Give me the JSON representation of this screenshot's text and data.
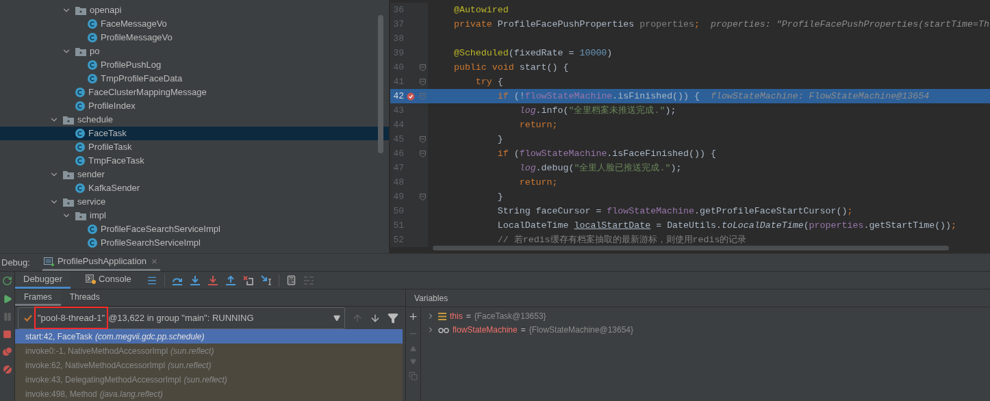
{
  "project_tree": {
    "items": [
      {
        "children": [
          {
            "label": "openapi",
            "kind": "folder",
            "expanded": true,
            "selected": false,
            "children": [
              {
                "label": "FaceMessageVo",
                "kind": "class",
                "selected": false
              },
              {
                "label": "ProfileMessageVo",
                "kind": "class",
                "selected": false
              }
            ]
          },
          {
            "label": "po",
            "kind": "folder",
            "expanded": true,
            "selected": false,
            "children": [
              {
                "label": "ProfilePushLog",
                "kind": "class",
                "selected": false
              },
              {
                "label": "TmpProfileFaceData",
                "kind": "class",
                "selected": false
              }
            ]
          },
          {
            "label": "FaceClusterMappingMessage",
            "kind": "class",
            "selected": false
          },
          {
            "label": "ProfileIndex",
            "kind": "class",
            "selected": false
          }
        ]
      },
      {
        "label": "schedule",
        "kind": "folder",
        "expanded": true,
        "selected": false,
        "children": [
          {
            "label": "FaceTask",
            "kind": "class",
            "selected": true
          },
          {
            "label": "ProfileTask",
            "kind": "class",
            "selected": false
          },
          {
            "label": "TmpFaceTask",
            "kind": "class",
            "selected": false
          }
        ]
      },
      {
        "label": "sender",
        "kind": "folder",
        "expanded": true,
        "selected": false,
        "children": [
          {
            "label": "KafkaSender",
            "kind": "class",
            "selected": false
          }
        ]
      },
      {
        "label": "service",
        "kind": "folder",
        "expanded": true,
        "selected": false,
        "children": [
          {
            "label": "impl",
            "kind": "folder",
            "expanded": true,
            "selected": false,
            "children": [
              {
                "label": "ProfileFaceSearchServiceImpl",
                "kind": "class",
                "selected": false
              },
              {
                "label": "ProfileSearchServiceImpl",
                "kind": "class",
                "selected": false
              }
            ]
          }
        ]
      }
    ]
  },
  "editor": {
    "lines": [
      {
        "n": "36",
        "fold": false,
        "breakpoint": false,
        "current": false,
        "tokens": [
          {
            "text": "    @Autowired",
            "kind": "ann"
          }
        ]
      },
      {
        "n": "37",
        "fold": false,
        "breakpoint": false,
        "current": false,
        "tokens": [
          {
            "text": "    private ",
            "kind": "kw"
          },
          {
            "text": "ProfileFacePushProperties ",
            "kind": "plain"
          },
          {
            "text": "properties",
            "kind": "unused"
          },
          {
            "text": ";",
            "kind": "kw"
          },
          {
            "text": "  properties: \"ProfileFacePushProperties(startTime=Th",
            "kind": "hint"
          }
        ]
      },
      {
        "n": "38",
        "fold": false,
        "breakpoint": false,
        "current": false
      },
      {
        "n": "39",
        "fold": false,
        "breakpoint": false,
        "current": false,
        "tokens": [
          {
            "text": "    @Scheduled",
            "kind": "ann"
          },
          {
            "text": "(fixedRate = ",
            "kind": "plain"
          },
          {
            "text": "10000",
            "kind": "num"
          },
          {
            "text": ")",
            "kind": "plain"
          }
        ]
      },
      {
        "n": "40",
        "fold": true,
        "breakpoint": false,
        "current": false,
        "tokens": [
          {
            "text": "    public void ",
            "kind": "kw"
          },
          {
            "text": "start() {",
            "kind": "plain"
          }
        ]
      },
      {
        "n": "41",
        "fold": true,
        "breakpoint": false,
        "current": false,
        "tokens": [
          {
            "text": "        try ",
            "kind": "kw"
          },
          {
            "text": "{",
            "kind": "plain"
          }
        ]
      },
      {
        "n": "42",
        "fold": true,
        "breakpoint": true,
        "current": true,
        "tokens": [
          {
            "text": "            if ",
            "kind": "kw"
          },
          {
            "text": "(!",
            "kind": "plain"
          },
          {
            "text": "flowStateMachine",
            "kind": "field"
          },
          {
            "text": ".isFinished()) {",
            "kind": "plain"
          },
          {
            "text": "  flowStateMachine: FlowStateMachine@13654",
            "kind": "hint"
          }
        ]
      },
      {
        "n": "43",
        "fold": false,
        "breakpoint": false,
        "current": false,
        "tokens": [
          {
            "text": "                log",
            "kind": "static"
          },
          {
            "text": ".info(",
            "kind": "plain"
          },
          {
            "text": "\"全里档案未推送完成.\"",
            "kind": "str"
          },
          {
            "text": ");",
            "kind": "plain"
          }
        ]
      },
      {
        "n": "44",
        "fold": false,
        "breakpoint": false,
        "current": false,
        "tokens": [
          {
            "text": "                return;",
            "kind": "kw"
          }
        ]
      },
      {
        "n": "45",
        "fold": true,
        "breakpoint": false,
        "current": false,
        "tokens": [
          {
            "text": "            }",
            "kind": "plain"
          }
        ]
      },
      {
        "n": "46",
        "fold": true,
        "breakpoint": false,
        "current": false,
        "tokens": [
          {
            "text": "            if ",
            "kind": "kw"
          },
          {
            "text": "(",
            "kind": "plain"
          },
          {
            "text": "flowStateMachine",
            "kind": "field"
          },
          {
            "text": ".isFaceFinished()) {",
            "kind": "plain"
          }
        ]
      },
      {
        "n": "47",
        "fold": false,
        "breakpoint": false,
        "current": false,
        "tokens": [
          {
            "text": "                log",
            "kind": "static"
          },
          {
            "text": ".debug(",
            "kind": "plain"
          },
          {
            "text": "\"全里人脸已推送完成.\"",
            "kind": "str"
          },
          {
            "text": ");",
            "kind": "plain"
          }
        ]
      },
      {
        "n": "48",
        "fold": false,
        "breakpoint": false,
        "current": false,
        "tokens": [
          {
            "text": "                return;",
            "kind": "kw"
          }
        ]
      },
      {
        "n": "49",
        "fold": true,
        "breakpoint": false,
        "current": false,
        "tokens": [
          {
            "text": "            }",
            "kind": "plain"
          }
        ]
      },
      {
        "n": "50",
        "fold": false,
        "breakpoint": false,
        "current": false,
        "tokens": [
          {
            "text": "            String faceCursor = ",
            "kind": "plain"
          },
          {
            "text": "flowStateMachine",
            "kind": "field"
          },
          {
            "text": ".getProfileFaceStartCursor()",
            "kind": "plain"
          },
          {
            "text": ";",
            "kind": "kw"
          }
        ]
      },
      {
        "n": "51",
        "fold": false,
        "breakpoint": false,
        "current": false,
        "tokens": [
          {
            "text": "            LocalDateTime ",
            "kind": "plain"
          },
          {
            "text": "localStartDate",
            "kind": "underline"
          },
          {
            "text": " = DateUtils.",
            "kind": "plain"
          },
          {
            "text": "toLocalDateTime",
            "kind": "italic"
          },
          {
            "text": "(",
            "kind": "plain"
          },
          {
            "text": "properties",
            "kind": "field"
          },
          {
            "text": ".getStartTime())",
            "kind": "plain"
          },
          {
            "text": ";",
            "kind": "kw"
          }
        ]
      },
      {
        "n": "52",
        "fold": false,
        "breakpoint": false,
        "current": false,
        "tokens": [
          {
            "text": "            // 若redis缓存有档案抽取的最新游标，则使用redis的记录",
            "kind": "comment"
          }
        ]
      }
    ]
  },
  "debug": {
    "label": "Debug:",
    "session_tab": {
      "label": "ProfilePushApplication",
      "close": "×"
    },
    "tabs": [
      {
        "label": "Debugger",
        "selected": true
      },
      {
        "label": "Console",
        "selected": false
      }
    ],
    "subtabs": [
      {
        "label": "Frames",
        "selected": true
      },
      {
        "label": "Threads",
        "selected": false
      }
    ],
    "thread": {
      "name": "\"pool-8-thread-1\"",
      "detail": "@13,622 in group \"main\": RUNNING",
      "annotated": true
    },
    "frames": [
      {
        "method": "start:42, FaceTask",
        "package": "(com.megvii.gdc.pp.schedule)",
        "selected": true
      },
      {
        "method": "invoke0:-1, NativeMethodAccessorImpl",
        "package": "(sun.reflect)",
        "selected": false
      },
      {
        "method": "invoke:62, NativeMethodAccessorImpl",
        "package": "(sun.reflect)",
        "selected": false
      },
      {
        "method": "invoke:43, DelegatingMethodAccessorImpl",
        "package": "(sun.reflect)",
        "selected": false
      },
      {
        "method": "invoke:498, Method",
        "package": "(java.lang.reflect)",
        "selected": false
      }
    ],
    "variables_title": "Variables",
    "variables": [
      {
        "kind": "object",
        "name": "this",
        "eq": "=",
        "value": "{FaceTask@13653}"
      },
      {
        "kind": "watch",
        "name": "flowStateMachine",
        "eq": "=",
        "value": "{FlowStateMachine@13654}"
      }
    ]
  }
}
